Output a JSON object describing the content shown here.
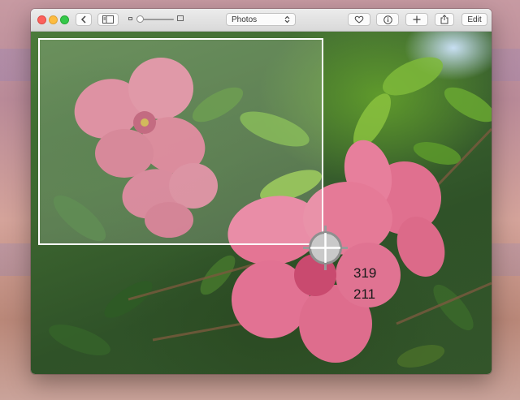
{
  "toolbar": {
    "back_icon": "chevron-left-icon",
    "sidebar_icon": "sidebar-icon",
    "album_select": "Photos",
    "favorite_icon": "heart-icon",
    "info_icon": "info-icon",
    "add_icon": "plus-icon",
    "share_icon": "share-icon",
    "edit_label": "Edit"
  },
  "screenshot_tool": {
    "x": "319",
    "y": "211"
  },
  "colors": {
    "close": "#fc605c",
    "minimize": "#fdbc40",
    "zoom": "#34c84a",
    "selection": "#ffffff",
    "crosshair": "#9a9a9a"
  }
}
